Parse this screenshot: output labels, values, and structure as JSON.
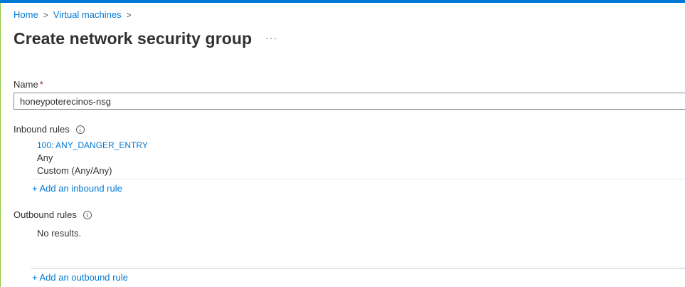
{
  "breadcrumb": {
    "items": [
      {
        "label": "Home"
      },
      {
        "label": "Virtual machines"
      }
    ],
    "separator": ">"
  },
  "page": {
    "title": "Create network security group",
    "more_label": "···"
  },
  "form": {
    "name_label": "Name",
    "required_mark": "*",
    "name_value": "honeypoterecinos-nsg"
  },
  "inbound": {
    "label": "Inbound rules",
    "rules": [
      {
        "title": "100: ANY_DANGER_ENTRY",
        "source": "Any",
        "destination": "Custom (Any/Any)"
      }
    ],
    "add_label": "+ Add an inbound rule"
  },
  "outbound": {
    "label": "Outbound rules",
    "empty_text": "No results.",
    "add_label": "+ Add an outbound rule"
  },
  "icons": {
    "info": "info-icon",
    "chevron": "chevron-right-icon"
  },
  "colors": {
    "accent": "#0078d4",
    "required": "#a4262c",
    "left_border": "#8cc63f"
  }
}
